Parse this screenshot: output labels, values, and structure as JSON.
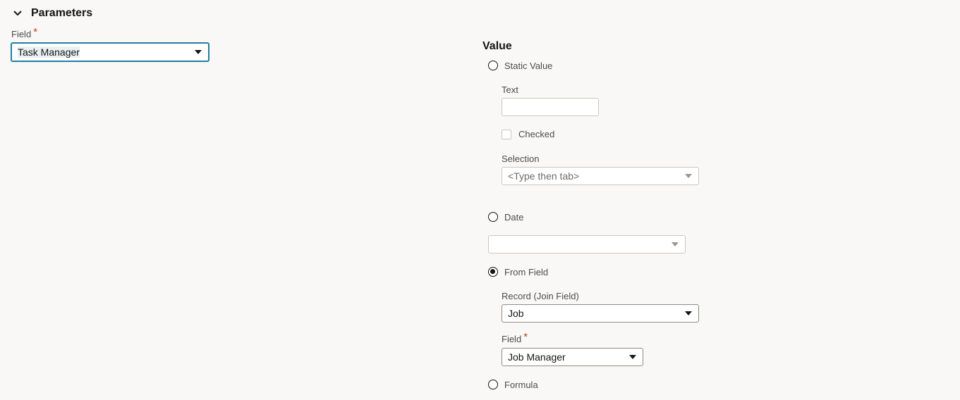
{
  "section": {
    "title": "Parameters"
  },
  "left_field": {
    "label": "Field",
    "required_mark": "*",
    "value": "Task Manager"
  },
  "value_panel": {
    "heading": "Value",
    "options": {
      "static_value": "Static Value",
      "date": "Date",
      "from_field": "From Field",
      "formula": "Formula"
    },
    "selected_option": "from_field",
    "static": {
      "text_label": "Text",
      "text_value": "",
      "checked_label": "Checked",
      "selection_label": "Selection",
      "selection_placeholder": "<Type then tab>"
    },
    "date": {
      "value": ""
    },
    "from_field": {
      "record_label": "Record (Join Field)",
      "record_value": "Job",
      "field_label": "Field",
      "field_required_mark": "*",
      "field_value": "Job Manager"
    }
  },
  "colors": {
    "background": "#f9f8f6",
    "focus_border": "#227e9e",
    "required": "#b34a15"
  }
}
